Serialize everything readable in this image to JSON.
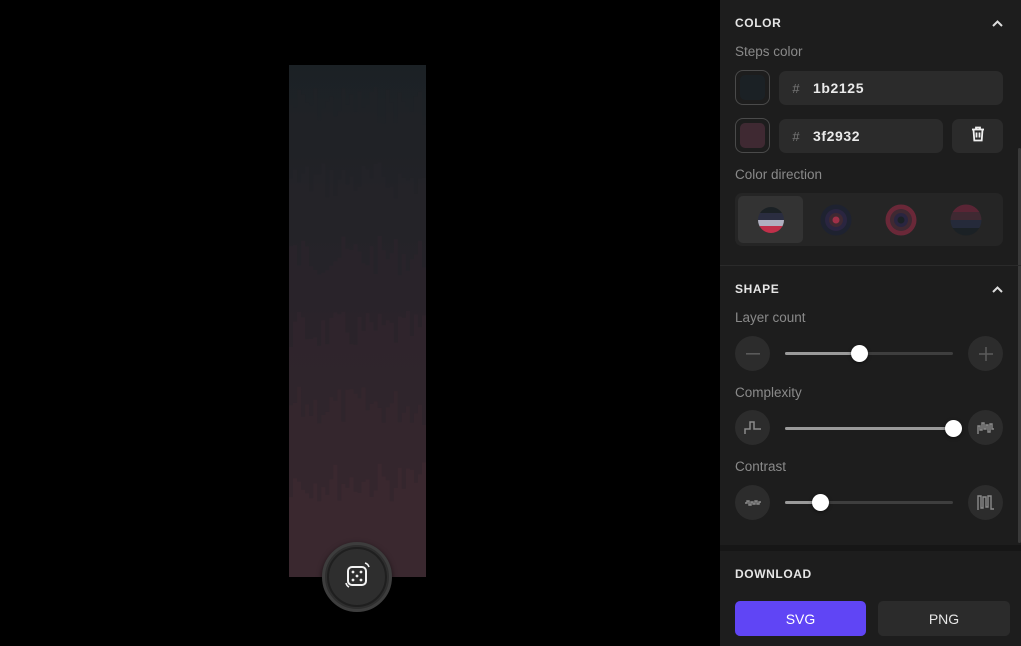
{
  "colors": {
    "step_start": "#1b2125",
    "step_end": "#3f2932",
    "accent": "#6045f5"
  },
  "color_section": {
    "title": "COLOR",
    "steps_label": "Steps color",
    "hash": "#",
    "color1_hex": "1b2125",
    "color2_hex": "3f2932",
    "direction_label": "Color direction",
    "directions": [
      "top-to-bottom",
      "radial-inward",
      "radial-outward",
      "bottom-to-top"
    ],
    "active_direction": 0
  },
  "shape_section": {
    "title": "SHAPE",
    "layer_count": {
      "label": "Layer count",
      "value": 0.44
    },
    "complexity": {
      "label": "Complexity",
      "value": 1.0
    },
    "contrast": {
      "label": "Contrast",
      "value": 0.21
    }
  },
  "download_section": {
    "title": "DOWNLOAD",
    "svg_label": "SVG",
    "png_label": "PNG"
  },
  "icons": {
    "collapse": "chevron-up-icon",
    "delete": "trash-icon",
    "minus": "minus-icon",
    "plus": "plus-icon",
    "randomize": "dice-icon"
  }
}
